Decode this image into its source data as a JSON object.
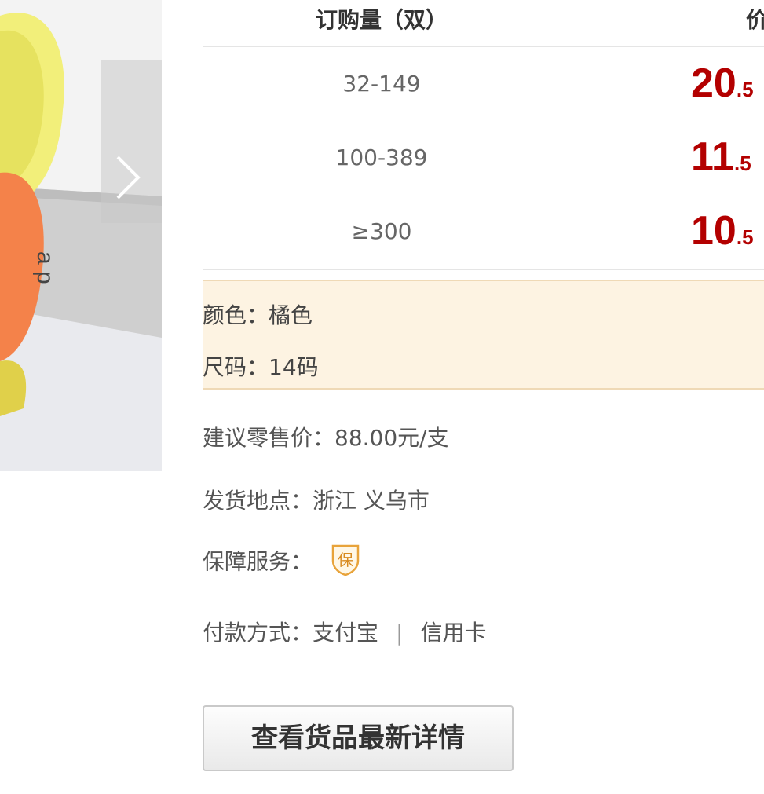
{
  "gallery": {
    "image_text": "a p"
  },
  "price_table": {
    "headers": {
      "quantity": "订购量（双）",
      "price": "价"
    },
    "rows": [
      {
        "range": "32-149",
        "price_int": "20",
        "price_dec": ".5"
      },
      {
        "range": "100-389",
        "price_int": "11",
        "price_dec": ".5"
      },
      {
        "range": "≥300",
        "price_int": "10",
        "price_dec": ".5"
      }
    ]
  },
  "spec": {
    "color_label": "颜色：",
    "color_value": "橘色",
    "size_label": "尺码：",
    "size_value": "14码"
  },
  "info": {
    "retail_label": "建议零售价：",
    "retail_value": "88.00元/支",
    "ship_label": "发货地点：",
    "ship_value": "浙江 义乌市",
    "service_label": "保障服务：",
    "service_badge": "保",
    "pay_label": "付款方式：",
    "pay_method_1": "支付宝",
    "pay_separator": "|",
    "pay_method_2": "信用卡"
  },
  "cta": {
    "label": "查看货品最新详情"
  },
  "colors": {
    "price_red": "#b30000",
    "spec_bg": "#fdf3e2",
    "shield_orange": "#e8a33a"
  }
}
